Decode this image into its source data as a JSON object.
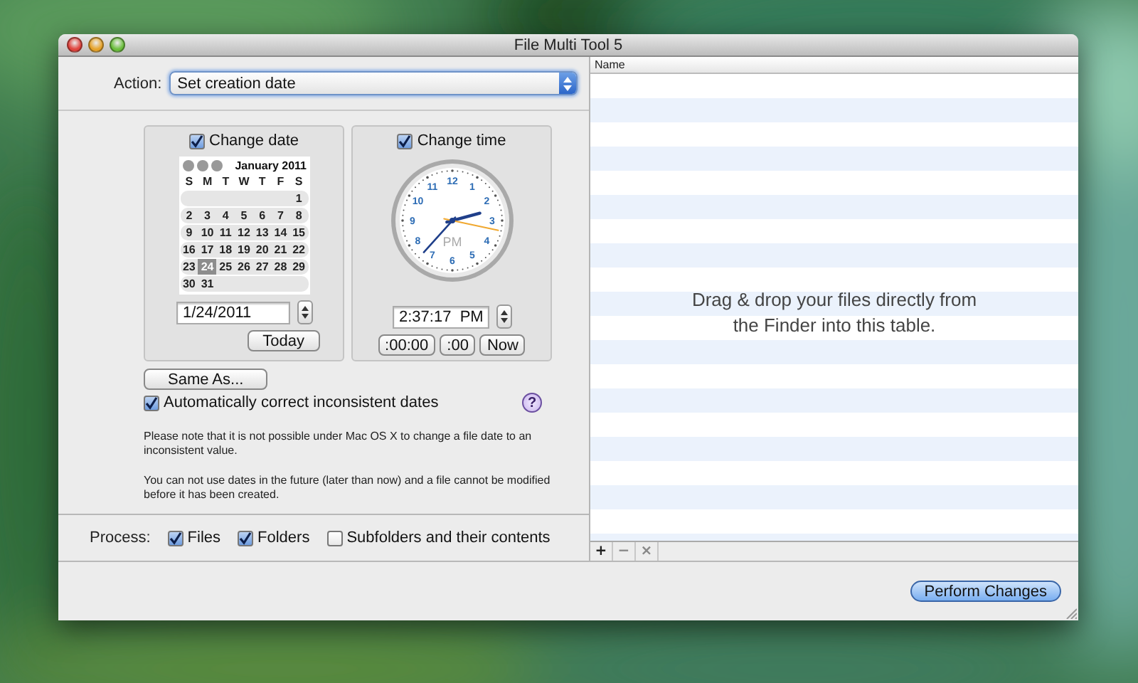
{
  "window": {
    "title": "File Multi Tool 5"
  },
  "action": {
    "label": "Action:",
    "value": "Set creation date"
  },
  "date_panel": {
    "checkbox": {
      "label": "Change date",
      "checked": true
    },
    "calendar": {
      "month": "January 2011",
      "weekdays": [
        "S",
        "M",
        "T",
        "W",
        "T",
        "F",
        "S"
      ],
      "weeks": [
        [
          {
            "day": "1",
            "selected": false
          }
        ],
        [
          {
            "day": "2",
            "selected": false
          },
          {
            "day": "3",
            "selected": false
          },
          {
            "day": "4",
            "selected": false
          },
          {
            "day": "5",
            "selected": false
          },
          {
            "day": "6",
            "selected": false
          },
          {
            "day": "7",
            "selected": false
          },
          {
            "day": "8",
            "selected": false
          }
        ],
        [
          {
            "day": "9",
            "selected": false
          },
          {
            "day": "10",
            "selected": false
          },
          {
            "day": "11",
            "selected": false
          },
          {
            "day": "12",
            "selected": false
          },
          {
            "day": "13",
            "selected": false
          },
          {
            "day": "14",
            "selected": false
          },
          {
            "day": "15",
            "selected": false
          }
        ],
        [
          {
            "day": "16",
            "selected": false
          },
          {
            "day": "17",
            "selected": false
          },
          {
            "day": "18",
            "selected": false
          },
          {
            "day": "19",
            "selected": false
          },
          {
            "day": "20",
            "selected": false
          },
          {
            "day": "21",
            "selected": false
          },
          {
            "day": "22",
            "selected": false
          }
        ],
        [
          {
            "day": "23",
            "selected": false
          },
          {
            "day": "24",
            "selected": true
          },
          {
            "day": "25",
            "selected": false
          },
          {
            "day": "26",
            "selected": false
          },
          {
            "day": "27",
            "selected": false
          },
          {
            "day": "28",
            "selected": false
          },
          {
            "day": "29",
            "selected": false
          }
        ],
        [
          {
            "day": "30",
            "selected": false
          },
          {
            "day": "31",
            "selected": false
          }
        ]
      ]
    },
    "field": "1/24/2011",
    "button": "Today"
  },
  "time_panel": {
    "checkbox": {
      "label": "Change time",
      "checked": true
    },
    "clock": {
      "numerals": [
        "12",
        "1",
        "2",
        "3",
        "4",
        "5",
        "6",
        "7",
        "8",
        "9",
        "10",
        "11"
      ],
      "period": "PM"
    },
    "field": "2:37:17  PM",
    "buttons": [
      ":00:00",
      ":00",
      "Now"
    ]
  },
  "same_as_button": "Same As...",
  "auto_correct": {
    "label": "Automatically correct inconsistent dates",
    "checked": true
  },
  "help_button": "?",
  "notes": [
    "Please note that it is not possible under Mac OS X to change a file date to an inconsistent value.",
    "You can not use dates in the future (later than now) and a file cannot be modified before it has been created."
  ],
  "process": {
    "label": "Process:",
    "options": [
      {
        "label": "Files",
        "checked": true
      },
      {
        "label": "Folders",
        "checked": true
      },
      {
        "label": "Subfolders and their contents",
        "checked": false
      }
    ]
  },
  "table": {
    "columns": [
      "Name"
    ],
    "empty_message": "Drag & drop your files directly from the Finder into this table.",
    "buttons": [
      "+",
      "−",
      "×"
    ]
  },
  "perform_button": "Perform Changes"
}
